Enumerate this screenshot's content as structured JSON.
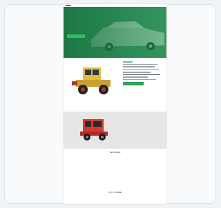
{
  "page": {
    "brand_color": "#1f9f4e",
    "hero": {
      "title_line1": "",
      "title_line2": "",
      "cta_label": ""
    },
    "product": {
      "title": "",
      "cta_label": ""
    },
    "section_title": "Die Modelle",
    "footer_text": "Toys · Modelle"
  }
}
